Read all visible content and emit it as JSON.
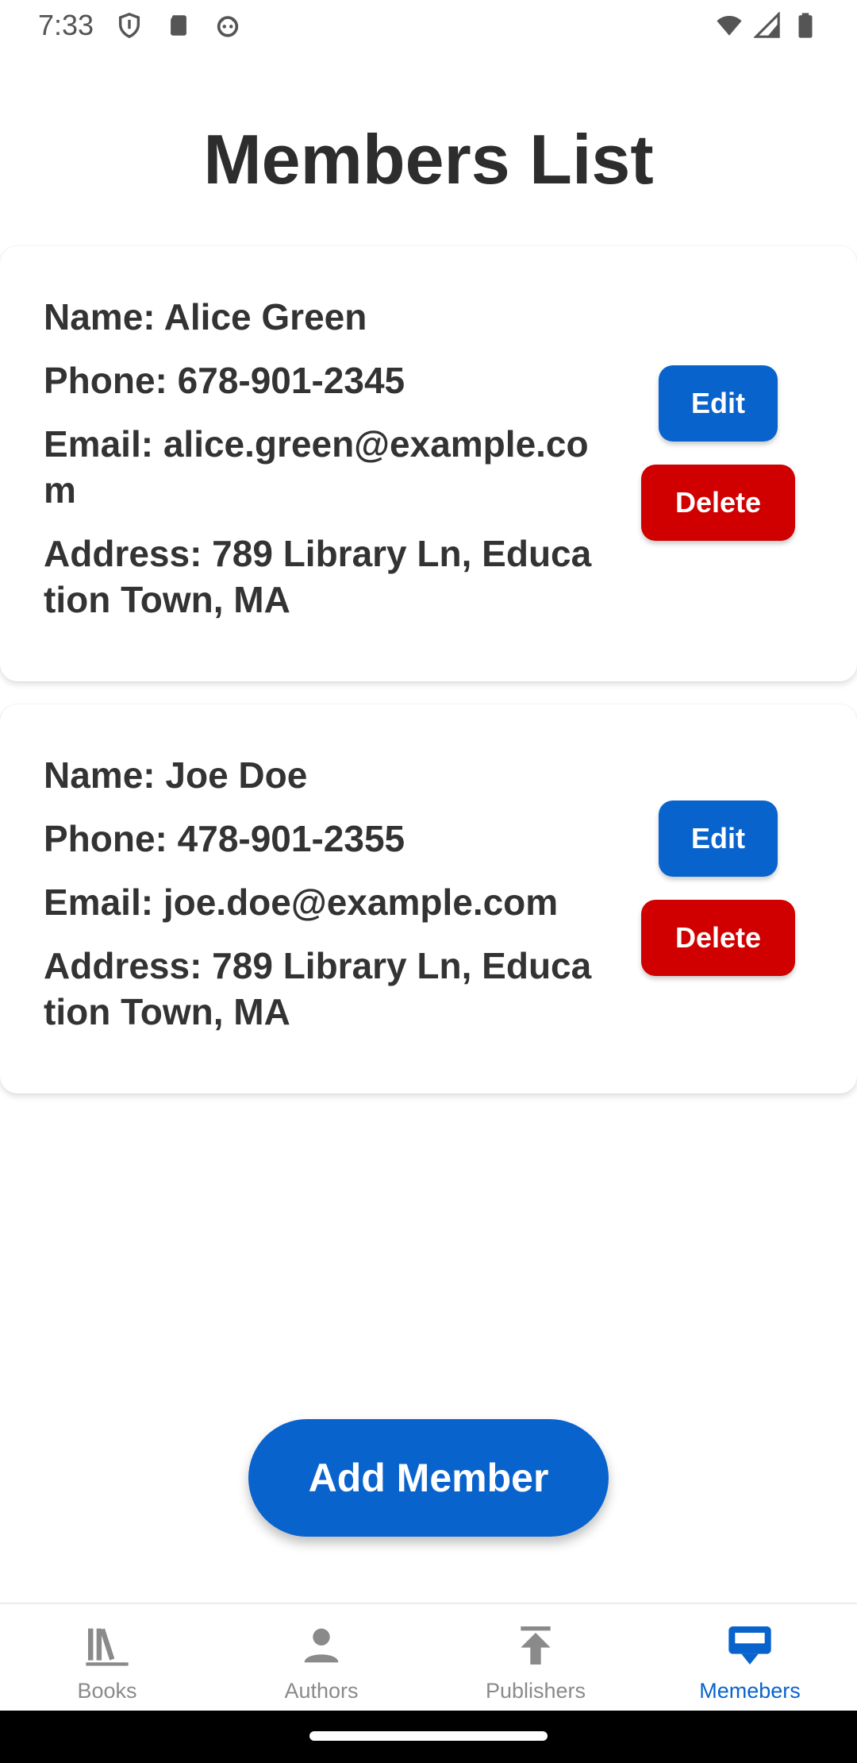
{
  "status_bar": {
    "time": "7:33",
    "icons_left": [
      "shield-icon",
      "sd-card-icon",
      "robot-face-icon"
    ],
    "icons_right": [
      "wifi-icon",
      "cell-signal-icon",
      "battery-icon"
    ]
  },
  "page": {
    "title": "Members List"
  },
  "members": [
    {
      "name": "Name: Alice Green",
      "phone": "Phone: 678-901-2345",
      "email": "Email: alice.green@example.com",
      "address": "Address: 789 Library Ln, Education Town, MA",
      "edit_label": "Edit",
      "delete_label": "Delete"
    },
    {
      "name": "Name: Joe Doe",
      "phone": "Phone: 478-901-2355",
      "email": "Email: joe.doe@example.com",
      "address": "Address: 789 Library Ln, Education Town, MA",
      "edit_label": "Edit",
      "delete_label": "Delete"
    }
  ],
  "add_member": {
    "label": "Add Member"
  },
  "bottom_nav": {
    "items": [
      {
        "label": "Books",
        "icon": "books-icon",
        "active": false
      },
      {
        "label": "Authors",
        "icon": "person-icon",
        "active": false
      },
      {
        "label": "Publishers",
        "icon": "publish-icon",
        "active": false
      },
      {
        "label": "Memebers",
        "icon": "members-card-icon",
        "active": true
      }
    ]
  },
  "colors": {
    "primary": "#0963cc",
    "danger": "#d10000",
    "inactive_nav": "#8a8a8a"
  }
}
